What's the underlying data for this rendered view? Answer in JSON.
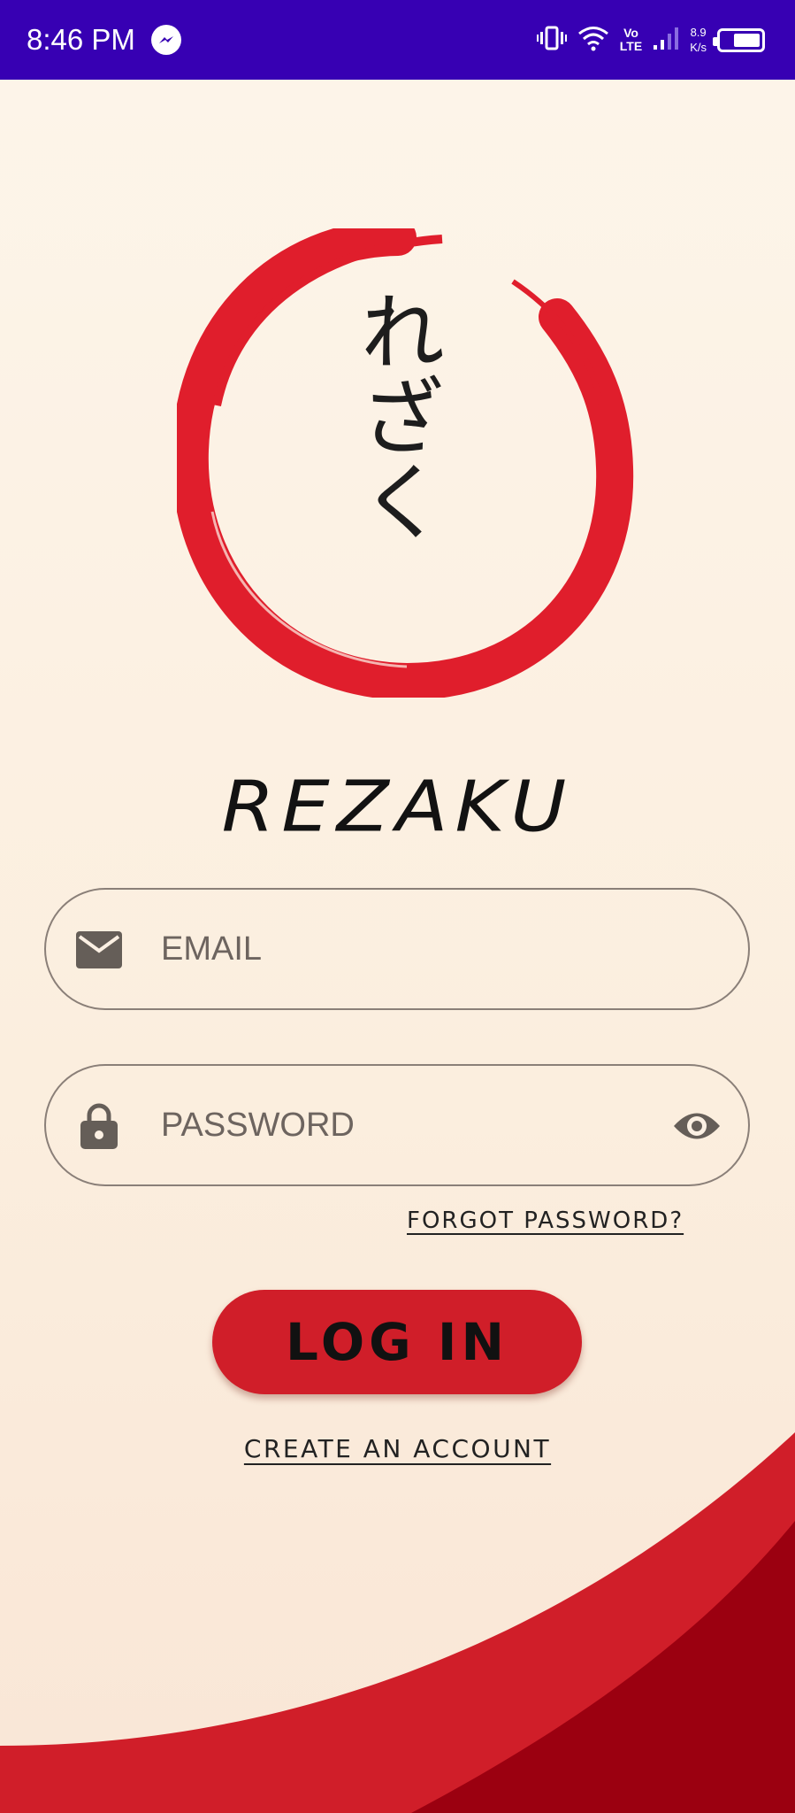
{
  "status_bar": {
    "time": "8:46 PM",
    "network_top": "Vo",
    "network_bottom": "LTE",
    "speed_value": "8.9",
    "speed_unit": "K/s",
    "icons": [
      "messenger-icon",
      "vibrate-icon",
      "wifi-icon",
      "signal-icon",
      "battery-icon"
    ]
  },
  "logo": {
    "kana": "れざく",
    "brand": "REZAKU"
  },
  "form": {
    "email_placeholder": "EMAIL",
    "password_placeholder": "PASSWORD",
    "forgot_password": "FORGOT PASSWORD?",
    "login_label": "LOG IN",
    "create_account": "CREATE AN ACCOUNT"
  },
  "colors": {
    "status_bar": "#3700b3",
    "accent_red": "#d01e29",
    "dark_red": "#9b0010",
    "background": "#fdf5ea"
  }
}
